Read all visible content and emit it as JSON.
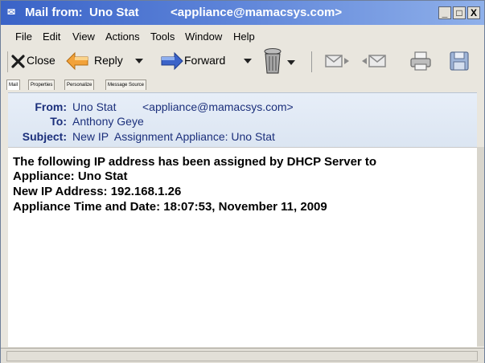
{
  "window": {
    "title": "Mail from:  Uno Stat",
    "title_address": "<appliance@mamacsys.com>",
    "controls": {
      "minimize": "_",
      "maximize": "□",
      "close": "X"
    }
  },
  "menu": {
    "items": [
      "File",
      "Edit",
      "View",
      "Actions",
      "Tools",
      "Window",
      "Help"
    ]
  },
  "toolbar": {
    "close_label": "Close",
    "reply_label": "Reply",
    "forward_label": "Forward"
  },
  "tabs": [
    "Mail",
    "Properties",
    "Personalize",
    "Message Source"
  ],
  "message": {
    "from_label": "From:",
    "from_name": "Uno Stat",
    "from_address": "<appliance@mamacsys.com>",
    "to_label": "To:",
    "to_value": "Anthony Geye",
    "subject_label": "Subject:",
    "subject_value": "New IP  Assignment Appliance: Uno Stat",
    "body_lines": [
      "The following IP address has been assigned by DHCP Server to",
      "Appliance: Uno Stat",
      "New IP Address: 192.168.1.26",
      "Appliance Time and Date: 18:07:53,  November 11, 2009"
    ]
  },
  "colors": {
    "title_bar": "#3a63c7",
    "header_text": "#1b2f7b",
    "header_bg": "#e7eef8"
  }
}
